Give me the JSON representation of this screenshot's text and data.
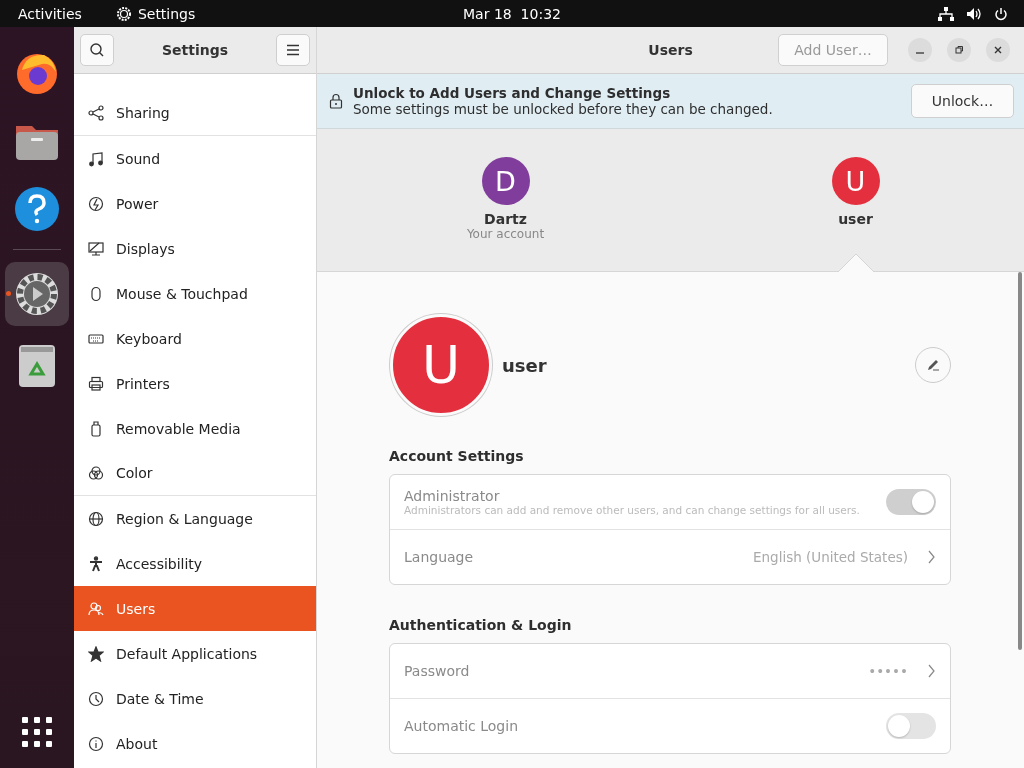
{
  "top_bar": {
    "activities": "Activities",
    "app_name": "Settings",
    "clock": "Mar 18  10:32"
  },
  "dock": [
    {
      "kind": "firefox",
      "active": false
    },
    {
      "kind": "files",
      "active": false
    },
    {
      "kind": "help",
      "active": false
    },
    {
      "kind": "settings",
      "active": true
    },
    {
      "kind": "trash",
      "active": false
    }
  ],
  "sidebar": {
    "title": "Settings",
    "items": [
      {
        "label": "Sharing",
        "kind": "share",
        "selected": false,
        "divider_after": true
      },
      {
        "label": "Sound",
        "kind": "note",
        "selected": false,
        "divider_after": false
      },
      {
        "label": "Power",
        "kind": "power",
        "selected": false,
        "divider_after": false
      },
      {
        "label": "Displays",
        "kind": "display",
        "selected": false,
        "divider_after": false
      },
      {
        "label": "Mouse & Touchpad",
        "kind": "mouse",
        "selected": false,
        "divider_after": false
      },
      {
        "label": "Keyboard",
        "kind": "keyboard",
        "selected": false,
        "divider_after": false
      },
      {
        "label": "Printers",
        "kind": "printer",
        "selected": false,
        "divider_after": false
      },
      {
        "label": "Removable Media",
        "kind": "usb",
        "selected": false,
        "divider_after": false
      },
      {
        "label": "Color",
        "kind": "color",
        "selected": false,
        "divider_after": true
      },
      {
        "label": "Region & Language",
        "kind": "globe",
        "selected": false,
        "divider_after": false
      },
      {
        "label": "Accessibility",
        "kind": "person",
        "selected": false,
        "divider_after": false
      },
      {
        "label": "Users",
        "kind": "users",
        "selected": true,
        "divider_after": false
      },
      {
        "label": "Default Applications",
        "kind": "star",
        "selected": false,
        "divider_after": false
      },
      {
        "label": "Date & Time",
        "kind": "clock",
        "selected": false,
        "divider_after": false
      },
      {
        "label": "About",
        "kind": "info",
        "selected": false,
        "divider_after": false
      }
    ]
  },
  "header": {
    "title": "Users",
    "add_button": {
      "label": "Add User…",
      "disabled": true
    }
  },
  "infobar": {
    "title": "Unlock to Add Users and Change Settings",
    "message": "Some settings must be unlocked before they can be changed.",
    "button": "Unlock…"
  },
  "users": [
    {
      "initial": "D",
      "name": "Dartz",
      "subtitle": "Your account",
      "color": "#813d9c",
      "selected": false
    },
    {
      "initial": "U",
      "name": "user",
      "color": "#e4303e",
      "selected": true
    }
  ],
  "profile": {
    "initial": "U",
    "name": "user",
    "color": "#e4303e"
  },
  "sections": [
    {
      "title": "Account Settings",
      "rows": [
        {
          "kind": "switch",
          "label": "Administrator",
          "description": "Administrators can add and remove other users, and can change settings for all users.",
          "on": true,
          "disabled": true
        },
        {
          "kind": "link",
          "label": "Language",
          "value": "English (United States)",
          "disabled": true
        }
      ]
    },
    {
      "title": "Authentication & Login",
      "rows": [
        {
          "kind": "link",
          "label": "Password",
          "value": "•••••",
          "disabled": true
        },
        {
          "kind": "switch",
          "label": "Automatic Login",
          "on": false,
          "disabled": true
        }
      ]
    }
  ]
}
